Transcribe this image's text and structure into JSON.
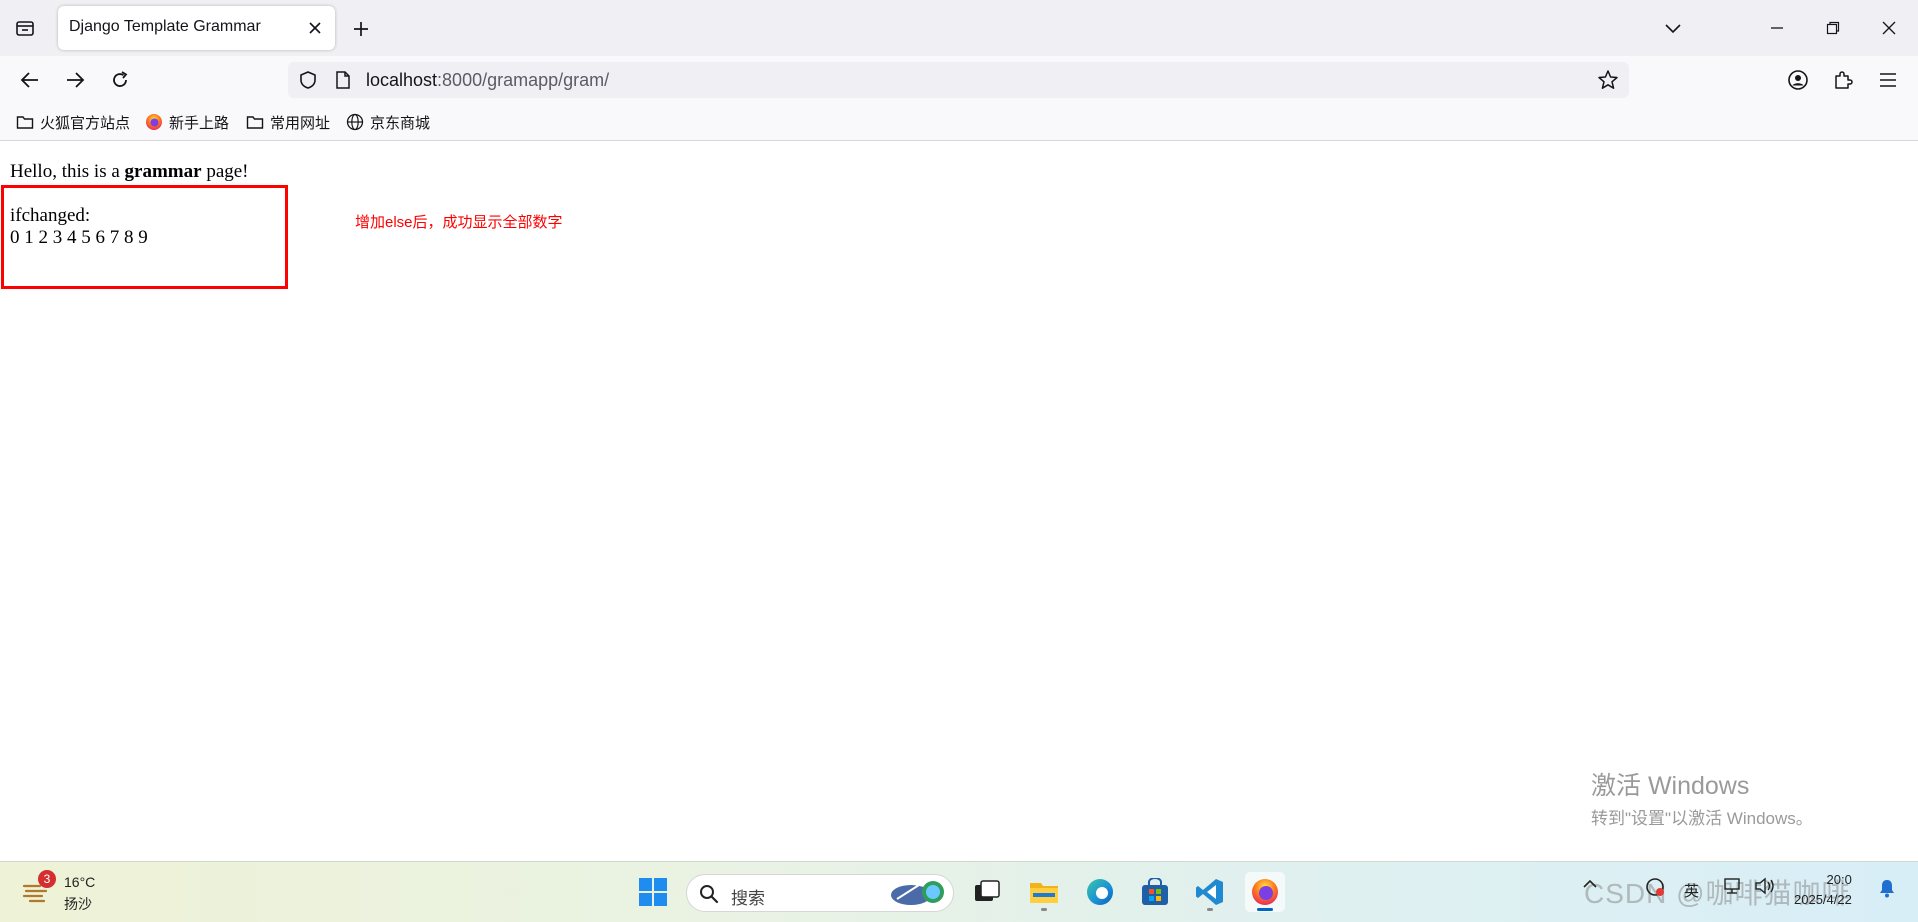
{
  "browser": {
    "tab_title": "Django Template Grammar",
    "url_host": "localhost",
    "url_path": ":8000/gramapp/gram/"
  },
  "bookmarks": [
    {
      "label": "火狐官方站点",
      "icon": "folder-icon"
    },
    {
      "label": "新手上路",
      "icon": "firefox-icon"
    },
    {
      "label": "常用网址",
      "icon": "folder-icon"
    },
    {
      "label": "京东商城",
      "icon": "globe-icon"
    }
  ],
  "page": {
    "hello_prefix": "Hello, this is a",
    "hello_bold": "grammar",
    "hello_suffix": "page!",
    "ifchanged_label": "ifchanged:",
    "ifchanged_values": "0 1 2 3 4 5 6 7 8 9",
    "annotation": "增加else后，成功显示全部数字",
    "annotation_color": "#ff0000"
  },
  "watermark": {
    "line1": "激活 Windows",
    "line2": "转到\"设置\"以激活 Windows。"
  },
  "taskbar": {
    "weather_badge": "3",
    "weather_temp": "16°C",
    "weather_desc": "扬沙",
    "search_placeholder": "搜索",
    "ime_label": "英",
    "clock_time": "20:0",
    "clock_date": "2025/4/22",
    "csdn_watermark": "CSDN @咖啡猫咖啡"
  }
}
